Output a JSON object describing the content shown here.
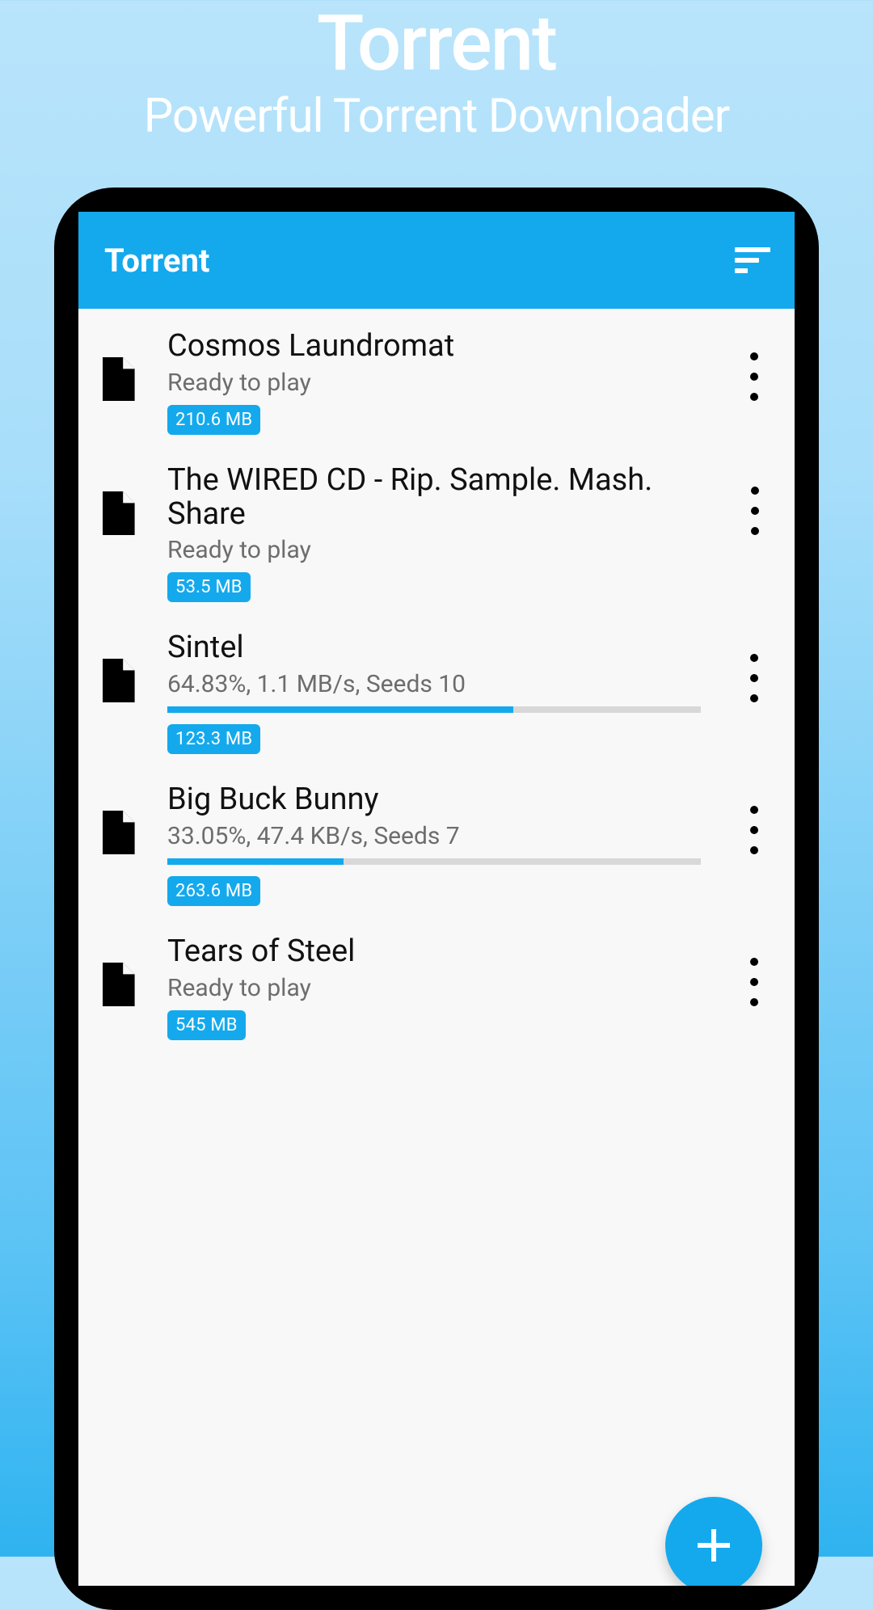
{
  "hero": {
    "title": "Torrent",
    "subtitle": "Powerful Torrent Downloader"
  },
  "app_bar": {
    "title": "Torrent"
  },
  "items": [
    {
      "title": "Cosmos Laundromat",
      "status": "Ready to play",
      "size": "210.6 MB",
      "progress": null
    },
    {
      "title": "The WIRED CD - Rip. Sample. Mash. Share",
      "status": "Ready to play",
      "size": "53.5 MB",
      "progress": null
    },
    {
      "title": "Sintel",
      "status": "64.83%, 1.1 MB/s, Seeds 10",
      "size": "123.3 MB",
      "progress": 64.83
    },
    {
      "title": "Big Buck Bunny",
      "status": "33.05%, 47.4 KB/s, Seeds 7",
      "size": "263.6 MB",
      "progress": 33.05
    },
    {
      "title": "Tears of Steel",
      "status": "Ready to play",
      "size": "545 MB",
      "progress": null
    }
  ],
  "colors": {
    "accent": "#14a9ed"
  }
}
